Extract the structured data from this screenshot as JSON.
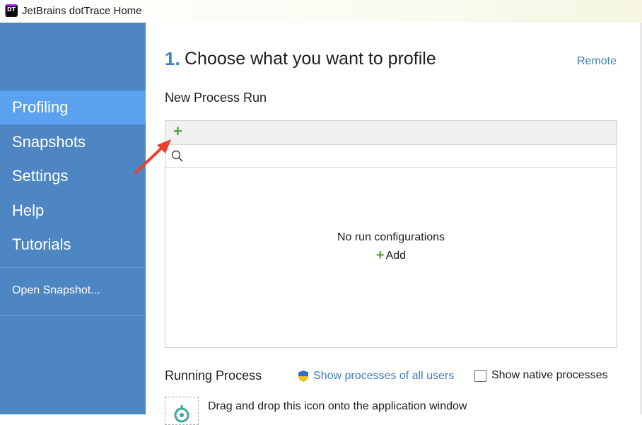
{
  "window": {
    "title": "JetBrains dotTrace Home",
    "logo_text": "DT"
  },
  "sidebar": {
    "items": [
      {
        "label": "Profiling",
        "active": true
      },
      {
        "label": "Snapshots",
        "active": false
      },
      {
        "label": "Settings",
        "active": false
      },
      {
        "label": "Help",
        "active": false
      },
      {
        "label": "Tutorials",
        "active": false
      }
    ],
    "open_snapshot": "Open Snapshot..."
  },
  "main": {
    "step_number": "1.",
    "heading": "Choose what you want to profile",
    "remote_link": "Remote",
    "new_process": {
      "title": "New Process Run",
      "search_placeholder": "",
      "empty_message": "No run configurations",
      "add_label": "Add"
    },
    "running_process": {
      "title": "Running Process",
      "show_all_users": "Show processes of all users",
      "show_native_label": "Show native processes",
      "show_native_checked": false,
      "drag_hint": "Drag and drop this icon onto the application window"
    }
  },
  "colors": {
    "sidebar_bg": "#4d86c2",
    "sidebar_active": "#5aa2ef",
    "link": "#3d7ec0",
    "add_green": "#4fa736",
    "annotation_arrow": "#e8422e"
  }
}
